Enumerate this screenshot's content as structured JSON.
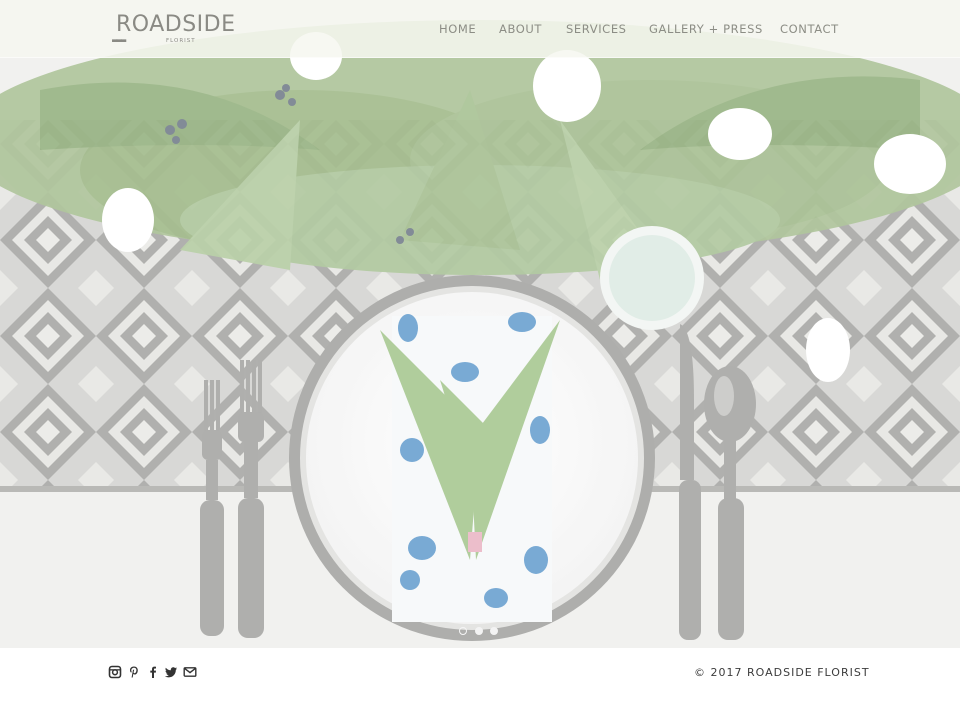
{
  "brand": {
    "name": "ROADSIDE",
    "tagline": "FLORIST"
  },
  "nav": {
    "items": [
      {
        "label": "HOME"
      },
      {
        "label": "ABOUT"
      },
      {
        "label": "SERVICES"
      },
      {
        "label": "GALLERY + PRESS"
      },
      {
        "label": "CONTACT"
      }
    ]
  },
  "hero": {
    "slides_count": 3,
    "active_slide": 1
  },
  "footer": {
    "social_icons": [
      "instagram-icon",
      "pinterest-icon",
      "facebook-icon",
      "twitter-icon",
      "email-icon"
    ],
    "copyright": "© 2017 ROADSIDE FLORIST"
  },
  "colors": {
    "nav_text": "#8c8d85",
    "header_bg": "#f6f7f0",
    "footer_text": "#3c3c3c",
    "foliage": "#7ea45e"
  }
}
